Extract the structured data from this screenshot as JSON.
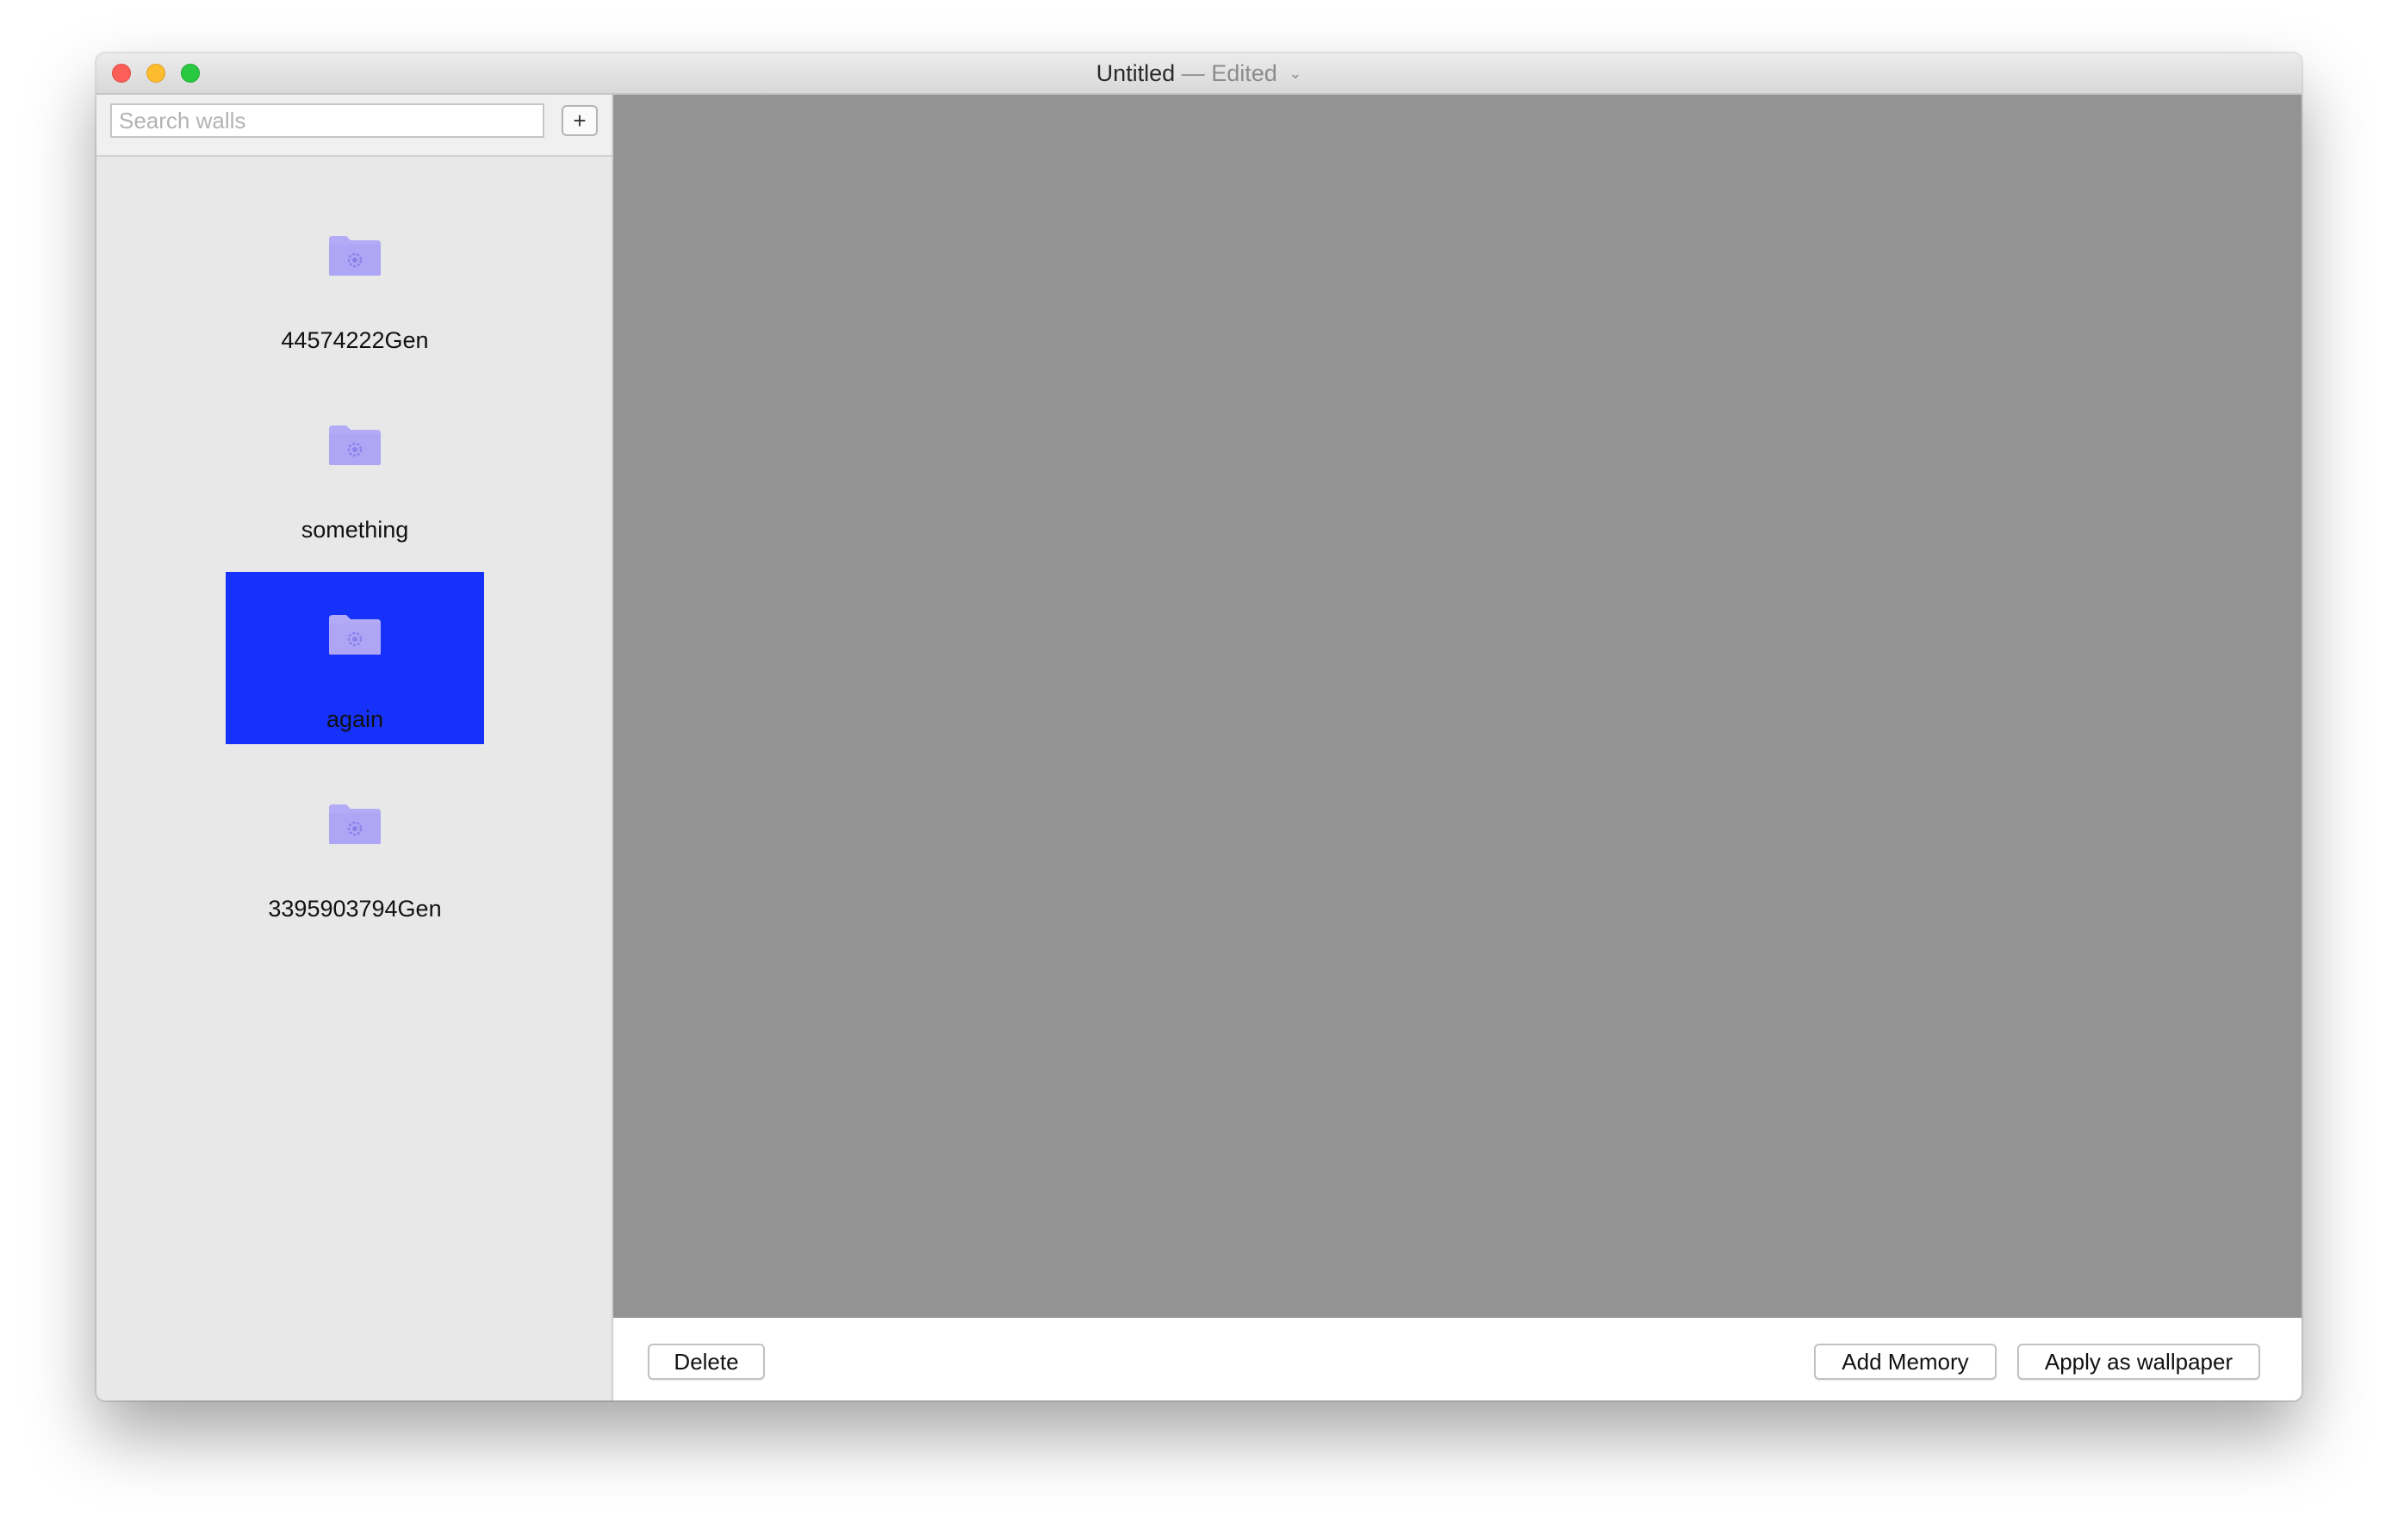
{
  "window": {
    "title": "Untitled",
    "status": "— Edited",
    "chevron": "⌄"
  },
  "search": {
    "placeholder": "Search walls",
    "value": "",
    "add_label": "+"
  },
  "walls": [
    {
      "label": "44574222Gen",
      "icon": "folder-icon",
      "selected": false
    },
    {
      "label": "something",
      "icon": "folder-icon",
      "selected": false
    },
    {
      "label": "again",
      "icon": "folder-icon",
      "selected": true
    },
    {
      "label": "3395903794Gen",
      "icon": "folder-icon",
      "selected": false
    }
  ],
  "actions": {
    "delete_label": "Delete",
    "add_memory_label": "Add Memory",
    "apply_label": "Apply as wallpaper"
  },
  "colors": {
    "selection": "#1632fa",
    "preview_bg": "#939393",
    "folder": "#aea6f5"
  }
}
